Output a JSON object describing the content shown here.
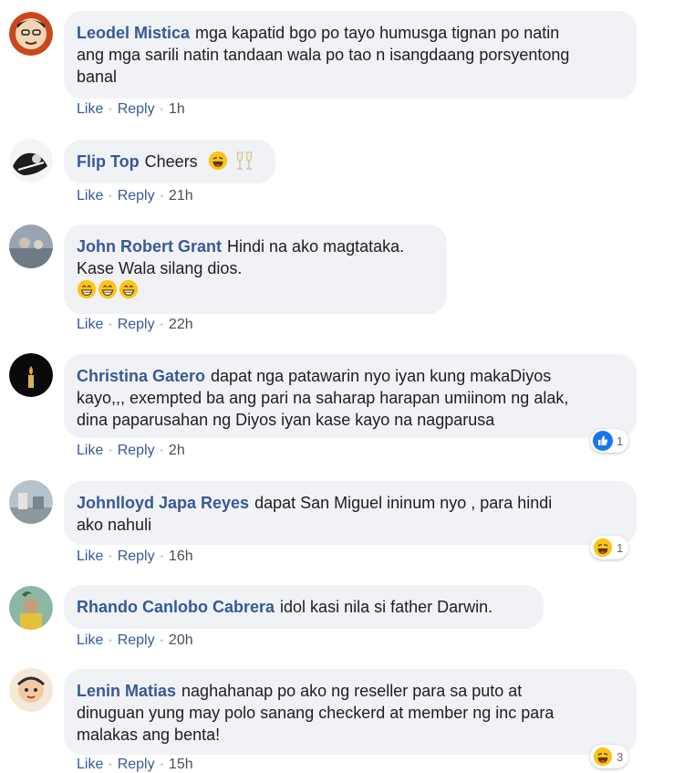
{
  "comments": [
    {
      "author": "Leodel Mistica",
      "lines": [
        "mga kapatid bgo po tayo humusga tignan po natin",
        "ang mga sarili natin tandaan wala po tao n isangdaang porsyentong",
        "banal"
      ],
      "like": "Like",
      "reply": "Reply",
      "time": "1h"
    },
    {
      "author": "Flip Top",
      "lines": [
        "Cheers"
      ],
      "like": "Like",
      "reply": "Reply",
      "time": "21h"
    },
    {
      "author": "John Robert Grant",
      "lines": [
        "Hindi na ako magtataka.",
        "Kase Wala silang dios."
      ],
      "like": "Like",
      "reply": "Reply",
      "time": "22h"
    },
    {
      "author": "Christina Gatero",
      "lines": [
        "dapat nga patawarin nyo iyan kung makaDiyos",
        "kayo,,, exempted ba ang pari na saharap harapan umiinom ng alak,",
        "dina paparusahan ng Diyos iyan kase kayo na nagparusa"
      ],
      "like": "Like",
      "reply": "Reply",
      "time": "2h",
      "reaction_count": "1",
      "reaction_icon": "like-icon"
    },
    {
      "author": "Johnlloyd Japa Reyes",
      "lines": [
        "dapat San Miguel ininum nyo , para hindi",
        "ako nahuli"
      ],
      "like": "Like",
      "reply": "Reply",
      "time": "16h",
      "reaction_count": "1",
      "reaction_icon": "haha-icon"
    },
    {
      "author": "Rhando Canlobo Cabrera",
      "lines": [
        "idol kasi nila si father Darwin."
      ],
      "like": "Like",
      "reply": "Reply",
      "time": "20h"
    },
    {
      "author": "Lenin Matias",
      "lines": [
        "naghahanap po ako ng reseller para sa puto at",
        "dinuguan yung may polo sanang checkerd at member ng inc para",
        "malakas ang benta!"
      ],
      "like": "Like",
      "reply": "Reply",
      "time": "15h",
      "reaction_count": "3",
      "reaction_icon": "haha-icon"
    }
  ],
  "colors": {
    "author": "#385898",
    "bubble": "#f0f2f5",
    "text": "#1c1e21",
    "meta": "#4b4f56"
  }
}
